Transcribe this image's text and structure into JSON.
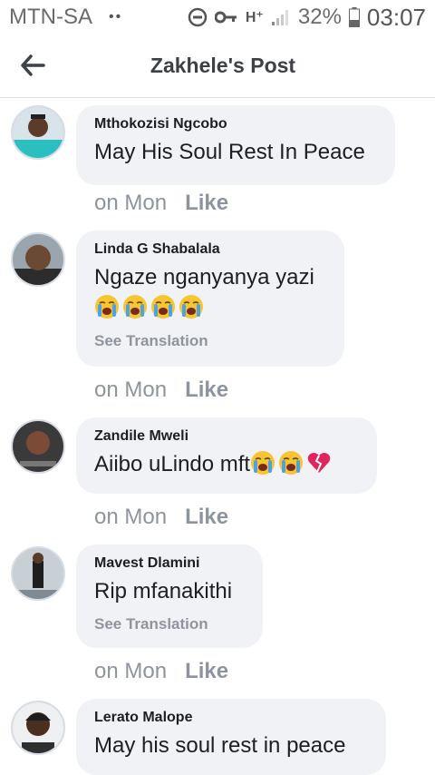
{
  "status_bar": {
    "carrier": "MTN-SA",
    "notification_dots": "••",
    "network": "H⁺",
    "battery_percent": "32%",
    "time": "03:07"
  },
  "header": {
    "title": "Zakhele's Post"
  },
  "comments": [
    {
      "author": "Mthokozisi Ngcobo",
      "text": "May His Soul Rest In Peace",
      "time": "on Mon",
      "like": "Like"
    },
    {
      "author": "Linda G Shabalala",
      "text": "Ngaze nganyanya yazi",
      "see_translation": "See Translation",
      "time": "on Mon",
      "like": "Like"
    },
    {
      "author": "Zandile Mweli",
      "text": "Aiibo uLindo mft",
      "time": "on Mon",
      "like": "Like"
    },
    {
      "author": "Mavest Dlamini",
      "text": "Rip mfanakithi",
      "see_translation": "See Translation",
      "time": "on Mon",
      "like": "Like"
    },
    {
      "author": "Lerato Malope",
      "text": "May his soul rest in peace"
    }
  ],
  "icons": {
    "back": "arrow-left-icon",
    "crying_emoji": "loudly-crying-face-emoji",
    "broken_heart": "broken-heart-emoji"
  },
  "colors": {
    "bubble_bg": "#f0f2f5",
    "meta_text": "#8d949e",
    "broken_heart": "#e0245e"
  }
}
